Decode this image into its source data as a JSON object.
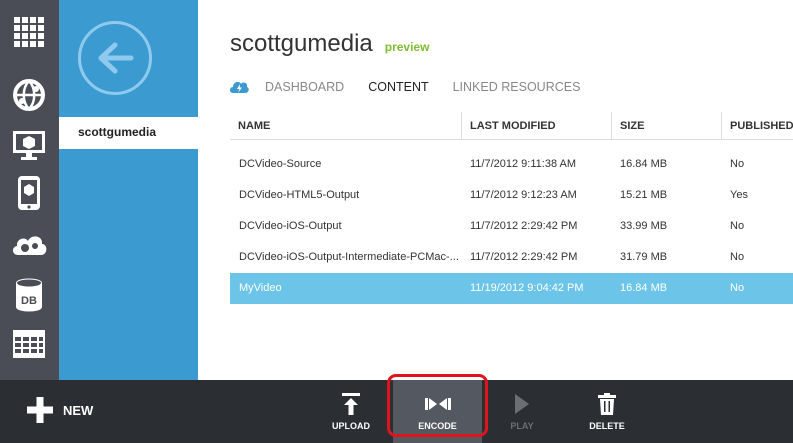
{
  "app": {
    "title": "scottgumedia",
    "badge": "preview"
  },
  "nav": {
    "selected_item": "scottgumedia"
  },
  "tabs": [
    {
      "label": "DASHBOARD",
      "active": false
    },
    {
      "label": "CONTENT",
      "active": true
    },
    {
      "label": "LINKED RESOURCES",
      "active": false
    }
  ],
  "table": {
    "columns": [
      "NAME",
      "LAST MODIFIED",
      "SIZE",
      "PUBLISHED"
    ],
    "rows": [
      {
        "name": "DCVideo-Source",
        "modified": "11/7/2012 9:11:38 AM",
        "size": "16.84 MB",
        "published": "No",
        "selected": false
      },
      {
        "name": "DCVideo-HTML5-Output",
        "modified": "11/7/2012 9:12:23 AM",
        "size": "15.21 MB",
        "published": "Yes",
        "selected": false
      },
      {
        "name": "DCVideo-iOS-Output",
        "modified": "11/7/2012 2:29:42 PM",
        "size": "33.99 MB",
        "published": "No",
        "selected": false
      },
      {
        "name": "DCVideo-iOS-Output-Intermediate-PCMac-...",
        "modified": "11/7/2012 2:29:42 PM",
        "size": "31.79 MB",
        "published": "No",
        "selected": false
      },
      {
        "name": "MyVideo",
        "modified": "11/19/2012 9:04:42 PM",
        "size": "16.84 MB",
        "published": "No",
        "selected": true
      }
    ]
  },
  "commandbar": {
    "new_label": "NEW",
    "upload_label": "UPLOAD",
    "encode_label": "ENCODE",
    "play_label": "PLAY",
    "delete_label": "DELETE"
  },
  "rail": {
    "icons": [
      "all-items-grid-icon",
      "websites-globe-icon",
      "virtual-machines-monitor-icon",
      "mobile-services-phone-icon",
      "cloud-services-gears-icon",
      "sql-databases-icon",
      "storage-table-icon"
    ],
    "db_text": "DB"
  },
  "colors": {
    "rail": "#4a4d55",
    "nav_panel": "#3b9bd1",
    "selected_row": "#6cc4e8",
    "preview_green": "#7fbc33",
    "command_bar": "#2b2e33",
    "highlight_red": "#e0141b"
  }
}
